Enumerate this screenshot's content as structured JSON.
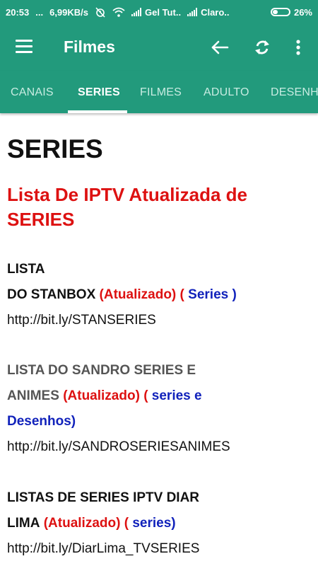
{
  "status_bar": {
    "time": "20:53",
    "dots": "...",
    "speed": "6,99KB/s",
    "carrier1": "Gel Tut..",
    "carrier2": "Claro..",
    "battery": "26%"
  },
  "app_bar": {
    "title": "Filmes",
    "icons": [
      "menu-icon",
      "back-arrow-icon",
      "sync-icon",
      "more-vert-icon"
    ]
  },
  "tabs": [
    {
      "label": "CANAIS"
    },
    {
      "label": "SERIES",
      "active": true
    },
    {
      "label": "FILMES"
    },
    {
      "label": "ADULTO"
    },
    {
      "label": "DESENH"
    }
  ],
  "page": {
    "heading": "SERIES",
    "subtitle": "Lista De IPTV Atualizada de SERIES"
  },
  "entries": [
    {
      "name_line1": "LISTA",
      "name_line2": "DO STANBOX",
      "updated": "(Atualizado)",
      "open_paren": "(",
      "category": "Series",
      "close_paren": ")",
      "url": "http://bit.ly/STANSERIES"
    },
    {
      "name_line1": "LISTA DO SANDRO SERIES E",
      "name_line2": "ANIMES",
      "updated": "(Atualizado)",
      "open_paren": "(",
      "category": "series e",
      "category_line2": "Desenhos)",
      "url": "http://bit.ly/SANDROSERIESANIMES"
    },
    {
      "name_line1": "LISTAS DE SERIES IPTV DIAR",
      "name_line2": "LIMA",
      "updated": "(Atualizado)",
      "open_paren": "(",
      "category": "series)",
      "url": "http://bit.ly/DiarLima_TVSERIES"
    }
  ],
  "colors": {
    "primary": "#229a7c",
    "updated_red": "#dd1111",
    "category_blue": "#1122bb"
  }
}
